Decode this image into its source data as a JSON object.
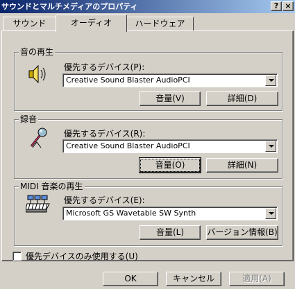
{
  "window": {
    "title": "サウンドとマルチメディアのプロパティ",
    "help_btn": "?",
    "close_btn": "×"
  },
  "tabs": [
    {
      "label": "サウンド",
      "active": false
    },
    {
      "label": "オーディオ",
      "active": true
    },
    {
      "label": "ハードウェア",
      "active": false
    }
  ],
  "playback": {
    "group_title": "音の再生",
    "icon": "speaker-icon",
    "device_label": "優先するデバイス(P):",
    "device_value": "Creative Sound Blaster AudioPCI",
    "volume_btn": "音量(V)",
    "advanced_btn": "詳細(D)"
  },
  "recording": {
    "group_title": "録音",
    "icon": "microphone-icon",
    "device_label": "優先するデバイス(R):",
    "device_value": "Creative Sound Blaster AudioPCI",
    "volume_btn": "音量(O)",
    "advanced_btn": "詳細(N)"
  },
  "midi": {
    "group_title": "MIDI 音楽の再生",
    "icon": "midi-keyboard-icon",
    "device_label": "優先するデバイス(E):",
    "device_value": "Microsoft GS Wavetable SW Synth",
    "volume_btn": "音量(L)",
    "about_btn": "バージョン情報(B)"
  },
  "preferred_only": {
    "label": "優先デバイスのみ使用する(U)",
    "checked": false
  },
  "footer": {
    "ok": "OK",
    "cancel": "キャンセル",
    "apply": "適用(A)"
  }
}
